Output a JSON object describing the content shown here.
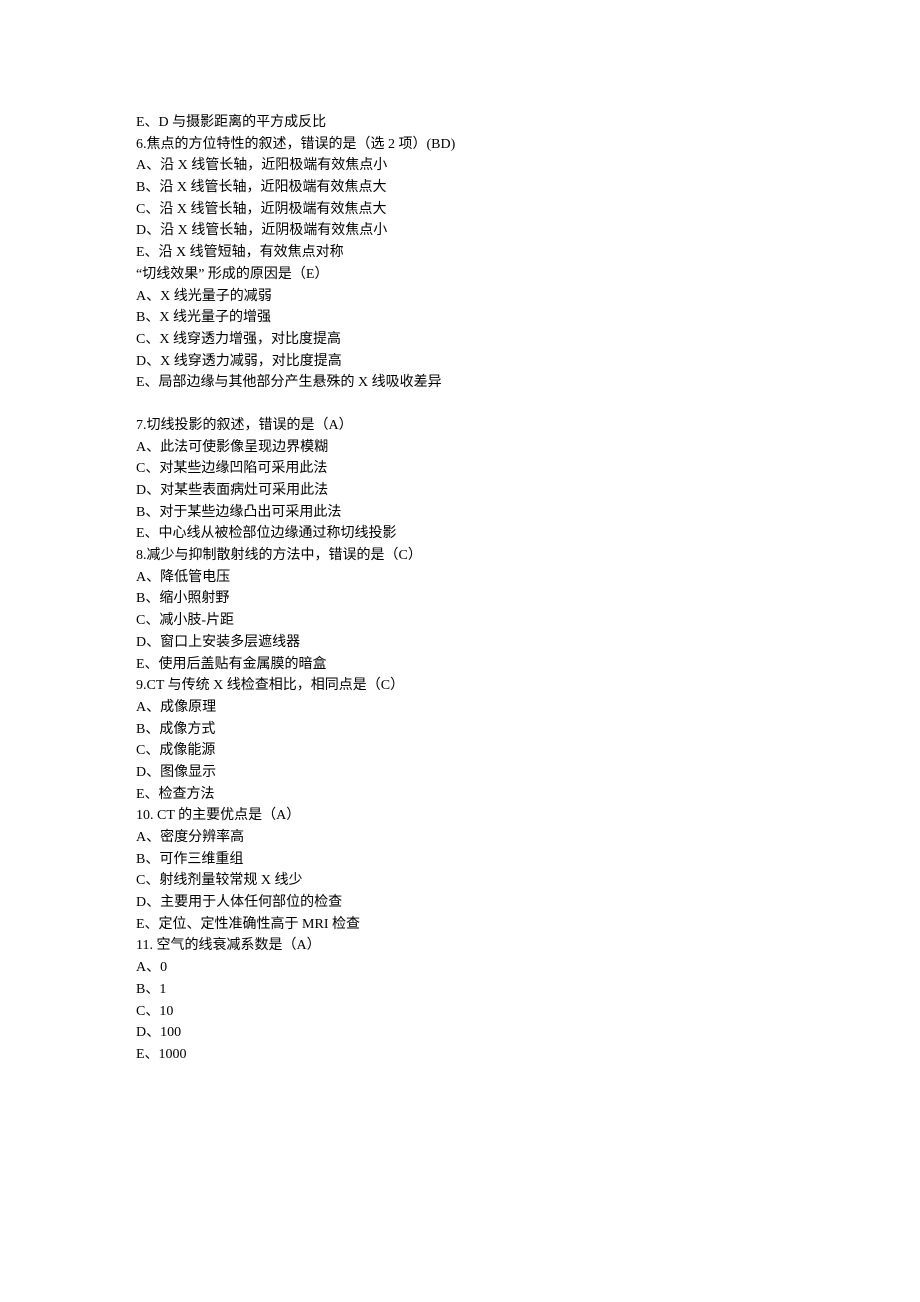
{
  "lines": [
    "E、D 与摄影距离的平方成反比",
    "6.焦点的方位特性的叙述，错误的是（选 2 项）(BD)",
    "A、沿 X 线管长轴，近阳极端有效焦点小",
    "B、沿 X 线管长轴，近阳极端有效焦点大",
    "C、沿 X 线管长轴，近阴极端有效焦点大",
    "D、沿 X 线管长轴，近阴极端有效焦点小",
    "E、沿 X 线管短轴，有效焦点对称",
    "“切线效果” 形成的原因是（E）",
    "A、X 线光量子的减弱",
    "B、X 线光量子的增强",
    "C、X 线穿透力增强，对比度提高",
    "D、X 线穿透力减弱，对比度提高",
    "E、局部边缘与其他部分产生悬殊的 X 线吸收差异",
    "",
    "7.切线投影的叙述，错误的是（A）",
    "A、此法可使影像呈现边界模糊",
    "C、对某些边缘凹陷可采用此法",
    "D、对某些表面病灶可采用此法",
    "B、对于某些边缘凸出可采用此法",
    "E、中心线从被检部位边缘通过称切线投影",
    "8.减少与抑制散射线的方法中，错误的是（C）",
    "A、降低管电压",
    "B、缩小照射野",
    "C、减小肢-片距",
    "D、窗口上安装多层遮线器",
    "E、使用后盖贴有金属膜的暗盒",
    "9.CT 与传统 X 线检查相比，相同点是（C）",
    "A、成像原理",
    "B、成像方式",
    "C、成像能源",
    "D、图像显示",
    "E、检查方法",
    "10. CT 的主要优点是（A）",
    "A、密度分辨率高",
    "B、可作三维重组",
    "C、射线剂量较常规 X 线少",
    "D、主要用于人体任何部位的检查",
    "E、定位、定性准确性高于 MRI 检查",
    "11. 空气的线衰减系数是（A）",
    "A、0",
    "B、1",
    "C、10",
    "D、100",
    "E、1000"
  ]
}
